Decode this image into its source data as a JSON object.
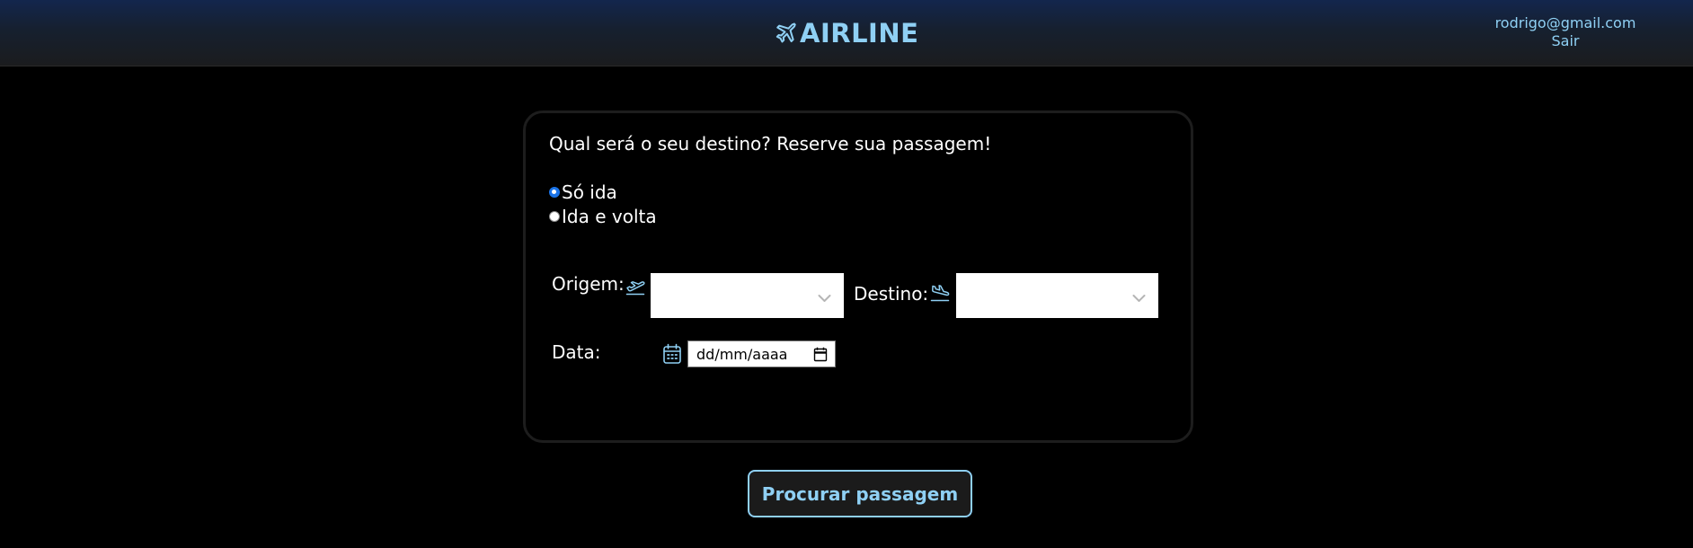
{
  "header": {
    "brand": "AIRLINE",
    "brand_icon": "airplane-icon",
    "user_email": "rodrigo@gmail.com",
    "logout_label": "Sair"
  },
  "form": {
    "question": "Qual será o seu destino? Reserve sua passagem!",
    "trip_types": [
      {
        "label": "Só ida",
        "checked": true
      },
      {
        "label": "Ida e volta",
        "checked": false
      }
    ],
    "origin": {
      "label": "Origem:",
      "icon": "plane-departure-icon",
      "value": ""
    },
    "destination": {
      "label": "Destino:",
      "icon": "plane-arrival-icon",
      "value": ""
    },
    "date": {
      "label": "Data:",
      "icon": "calendar-icon",
      "placeholder": "dd/mm/aaaa"
    }
  },
  "actions": {
    "search_label": "Procurar passagem"
  },
  "colors": {
    "accent": "#8fd0f4",
    "radio_checked": "#1a73e8",
    "background": "#000000"
  }
}
